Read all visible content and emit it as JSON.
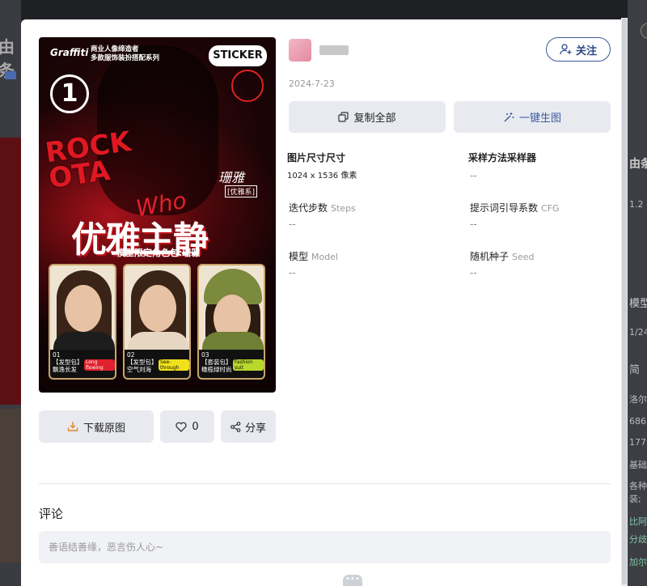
{
  "author": {
    "date": "2024-7-23"
  },
  "actions": {
    "follow_label": "关注",
    "copy_all_label": "复制全部",
    "generate_label": "一键生图",
    "download_label": "下载原图",
    "like_count": "0",
    "share_label": "分享"
  },
  "params": [
    {
      "label": "图片尺寸尺寸",
      "en": "",
      "value": "1024 x 1536 像素"
    },
    {
      "label": "采样方法采样器",
      "en": "",
      "value": "--"
    },
    {
      "label": "迭代步数",
      "en": "Steps",
      "value": "--"
    },
    {
      "label": "提示词引导系数",
      "en": "CFG",
      "value": "--"
    },
    {
      "label": "模型",
      "en": "Model",
      "value": "--"
    },
    {
      "label": "随机种子",
      "en": "Seed",
      "value": "--"
    }
  ],
  "comments": {
    "title": "评论",
    "placeholder": "善语结善缘，恶言伤人心~"
  },
  "poster": {
    "brand": "Graffiti",
    "top_line1": "商业人像缔造者",
    "top_line2": "多款服饰装扮搭配系列",
    "sticker": "STICKER",
    "number": "1",
    "rock": "ROCK",
    "rock2": "OTA",
    "signature": "珊雅",
    "series": "[优雅系]",
    "who": "Who",
    "title": "优雅主静",
    "subtitle": "模型限定角色包:珊雅",
    "cards": [
      {
        "label1": "01",
        "label2": "【发型包】",
        "label3": "飘逸长发",
        "tag": "Long flowing"
      },
      {
        "label1": "02",
        "label2": "【发型包】",
        "label3": "空气刘海",
        "tag": "See-through"
      },
      {
        "label1": "03",
        "label2": "【套装包】",
        "label3": "橄榄绿时尚",
        "tag": "Fashion suit"
      }
    ]
  },
  "background": {
    "left_text": "由条",
    "right_lines": [
      "由条",
      "1.2",
      "模型",
      "1/24",
      "简",
      "洛尔",
      "686",
      "177",
      "基础",
      "各种",
      "装;",
      "比阿",
      "分歧",
      "加尔"
    ]
  },
  "colors": {
    "accent": "#2e4a8a",
    "button_bg": "#e8eaf0",
    "poster_red": "#e01822"
  },
  "icons": [
    "user-plus-icon",
    "copy-icon",
    "magic-wand-icon",
    "download-icon",
    "heart-icon",
    "share-icon",
    "more-dots-icon"
  ]
}
